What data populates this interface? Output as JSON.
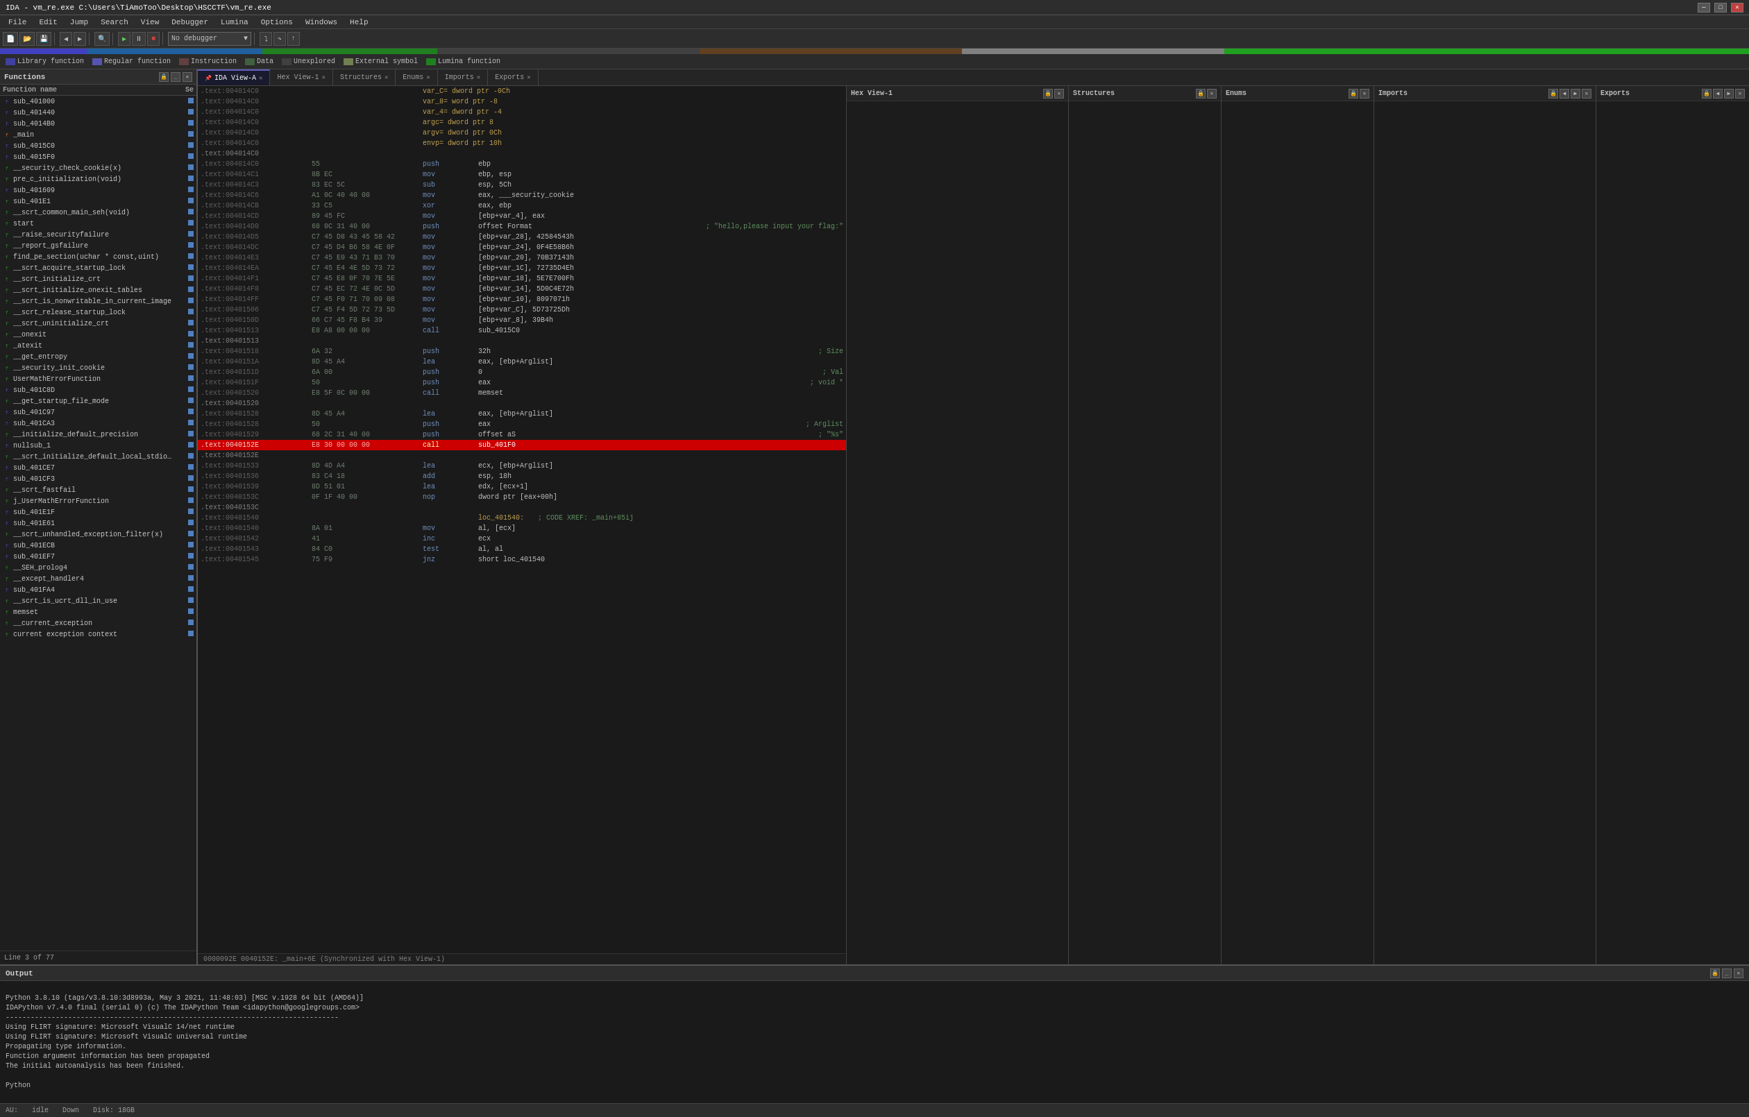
{
  "title_bar": {
    "title": "IDA - vm_re.exe C:\\Users\\TiAmoToo\\Desktop\\HSCCTF\\vm_re.exe",
    "min_label": "─",
    "max_label": "□",
    "close_label": "✕"
  },
  "menu": {
    "items": [
      "File",
      "Edit",
      "Jump",
      "Search",
      "View",
      "Debugger",
      "Lumina",
      "Options",
      "Windows",
      "Help"
    ]
  },
  "toolbar": {
    "debugger_dropdown": "No debugger"
  },
  "legend": {
    "items": [
      {
        "color": "#4040a0",
        "label": "Library function"
      },
      {
        "color": "#5050b0",
        "label": "Regular function"
      },
      {
        "color": "#604040",
        "label": "Instruction"
      },
      {
        "color": "#406040",
        "label": "Data"
      },
      {
        "color": "#404040",
        "label": "Unexplored"
      },
      {
        "color": "#708050",
        "label": "External symbol"
      },
      {
        "color": "#208020",
        "label": "Lumina function"
      }
    ]
  },
  "functions_panel": {
    "title": "Functions",
    "col_name": "Function name",
    "col_se": "Se",
    "items": [
      {
        "icon": "f",
        "icon_color": "#4040a0",
        "name": "sub_401000",
        "bar": 8
      },
      {
        "icon": "f",
        "icon_color": "#4040a0",
        "name": "sub_401440",
        "bar": 8
      },
      {
        "icon": "f",
        "icon_color": "#4040a0",
        "name": "sub_4014B0",
        "bar": 8
      },
      {
        "icon": "f",
        "icon_color": "#c06020",
        "name": "_main",
        "bar": 8
      },
      {
        "icon": "f",
        "icon_color": "#4040a0",
        "name": "sub_4015C0",
        "bar": 8
      },
      {
        "icon": "f",
        "icon_color": "#4040a0",
        "name": "sub_4015F0",
        "bar": 8
      },
      {
        "icon": "f",
        "icon_color": "#208020",
        "name": "__security_check_cookie(x)",
        "bar": 8
      },
      {
        "icon": "f",
        "icon_color": "#208020",
        "name": "pre_c_initialization(void)",
        "bar": 8
      },
      {
        "icon": "f",
        "icon_color": "#4040a0",
        "name": "sub_401609",
        "bar": 8
      },
      {
        "icon": "f",
        "icon_color": "#208020",
        "name": "sub_401E1",
        "bar": 8
      },
      {
        "icon": "f",
        "icon_color": "#208020",
        "name": "__scrt_common_main_seh(void)",
        "bar": 8
      },
      {
        "icon": "f",
        "icon_color": "#208020",
        "name": "start",
        "bar": 8
      },
      {
        "icon": "f",
        "icon_color": "#208020",
        "name": "__raise_securityfailure",
        "bar": 8
      },
      {
        "icon": "f",
        "icon_color": "#208020",
        "name": "__report_gsfailure",
        "bar": 8
      },
      {
        "icon": "f",
        "icon_color": "#208020",
        "name": "find_pe_section(uchar * const,uint)",
        "bar": 8
      },
      {
        "icon": "f",
        "icon_color": "#208020",
        "name": "__scrt_acquire_startup_lock",
        "bar": 8
      },
      {
        "icon": "f",
        "icon_color": "#208020",
        "name": "__scrt_initialize_crt",
        "bar": 8
      },
      {
        "icon": "f",
        "icon_color": "#208020",
        "name": "__scrt_initialize_onexit_tables",
        "bar": 8
      },
      {
        "icon": "f",
        "icon_color": "#208020",
        "name": "__scrt_is_nonwritable_in_current_image",
        "bar": 8
      },
      {
        "icon": "f",
        "icon_color": "#208020",
        "name": "__scrt_release_startup_lock",
        "bar": 8
      },
      {
        "icon": "f",
        "icon_color": "#208020",
        "name": "__scrt_uninitialize_crt",
        "bar": 8
      },
      {
        "icon": "f",
        "icon_color": "#208020",
        "name": "__onexit",
        "bar": 8
      },
      {
        "icon": "f",
        "icon_color": "#208020",
        "name": "_atexit",
        "bar": 8
      },
      {
        "icon": "f",
        "icon_color": "#208020",
        "name": "__get_entropy",
        "bar": 8
      },
      {
        "icon": "f",
        "icon_color": "#208020",
        "name": "__security_init_cookie",
        "bar": 8
      },
      {
        "icon": "f",
        "icon_color": "#208020",
        "name": "UserMathErrorFunction",
        "bar": 8
      },
      {
        "icon": "f",
        "icon_color": "#4040a0",
        "name": "sub_401C8D",
        "bar": 8
      },
      {
        "icon": "f",
        "icon_color": "#208020",
        "name": "__get_startup_file_mode",
        "bar": 8
      },
      {
        "icon": "f",
        "icon_color": "#4040a0",
        "name": "sub_401C97",
        "bar": 8
      },
      {
        "icon": "f",
        "icon_color": "#4040a0",
        "name": "sub_401CA3",
        "bar": 8
      },
      {
        "icon": "f",
        "icon_color": "#208020",
        "name": "__initialize_default_precision",
        "bar": 8
      },
      {
        "icon": "f",
        "icon_color": "#4040a0",
        "name": "nullsub_1",
        "bar": 8
      },
      {
        "icon": "f",
        "icon_color": "#208020",
        "name": "__scrt_initialize_default_local_stdio_opti...",
        "bar": 8
      },
      {
        "icon": "f",
        "icon_color": "#4040a0",
        "name": "sub_401CE7",
        "bar": 8
      },
      {
        "icon": "f",
        "icon_color": "#4040a0",
        "name": "sub_401CF3",
        "bar": 8
      },
      {
        "icon": "f",
        "icon_color": "#208020",
        "name": "__scrt_fastfail",
        "bar": 8
      },
      {
        "icon": "f",
        "icon_color": "#208020",
        "name": "j_UserMathErrorFunction",
        "bar": 8
      },
      {
        "icon": "f",
        "icon_color": "#4040a0",
        "name": "sub_401E1F",
        "bar": 8
      },
      {
        "icon": "f",
        "icon_color": "#4040a0",
        "name": "sub_401E61",
        "bar": 8
      },
      {
        "icon": "f",
        "icon_color": "#208020",
        "name": "__scrt_unhandled_exception_filter(x)",
        "bar": 8
      },
      {
        "icon": "f",
        "icon_color": "#4040a0",
        "name": "sub_401ECB",
        "bar": 8
      },
      {
        "icon": "f",
        "icon_color": "#4040a0",
        "name": "sub_401EF7",
        "bar": 8
      },
      {
        "icon": "f",
        "icon_color": "#208020",
        "name": "__SEH_prolog4",
        "bar": 8
      },
      {
        "icon": "f",
        "icon_color": "#208020",
        "name": "__except_handler4",
        "bar": 8
      },
      {
        "icon": "f",
        "icon_color": "#4040a0",
        "name": "sub_401FA4",
        "bar": 8
      },
      {
        "icon": "f",
        "icon_color": "#208020",
        "name": "__scrt_is_ucrt_dll_in_use",
        "bar": 8
      },
      {
        "icon": "f",
        "icon_color": "#208020",
        "name": "memset",
        "bar": 8
      },
      {
        "icon": "f",
        "icon_color": "#208020",
        "name": "__current_exception",
        "bar": 8
      },
      {
        "icon": "f",
        "icon_color": "#208020",
        "name": "current exception context",
        "bar": 8
      }
    ]
  },
  "tabs": {
    "items": [
      {
        "label": "IDA View-A",
        "active": true,
        "pin": true,
        "closeable": true
      },
      {
        "label": "Hex View-1",
        "active": false,
        "pin": false,
        "closeable": true
      },
      {
        "label": "Structures",
        "active": false,
        "pin": false,
        "closeable": true
      },
      {
        "label": "Enums",
        "active": false,
        "pin": false,
        "closeable": true
      },
      {
        "label": "Imports",
        "active": false,
        "pin": false,
        "closeable": true
      },
      {
        "label": "Exports",
        "active": false,
        "pin": false,
        "closeable": true
      }
    ]
  },
  "asm_view": {
    "lines": [
      {
        "addr": ".text:004014C0",
        "bytes": "",
        "mnem": "",
        "ops": "var_C= dword ptr -0Ch",
        "comment": "",
        "type": "var"
      },
      {
        "addr": ".text:004014C0",
        "bytes": "",
        "mnem": "",
        "ops": "var_8= word ptr -8",
        "comment": "",
        "type": "var"
      },
      {
        "addr": ".text:004014C0",
        "bytes": "",
        "mnem": "",
        "ops": "var_4= dword ptr -4",
        "comment": "",
        "type": "var"
      },
      {
        "addr": ".text:004014C0",
        "bytes": "",
        "mnem": "",
        "ops": "argc= dword ptr  8",
        "comment": "",
        "type": "var"
      },
      {
        "addr": ".text:004014C0",
        "bytes": "",
        "mnem": "",
        "ops": "argv= dword ptr  0Ch",
        "comment": "",
        "type": "var"
      },
      {
        "addr": ".text:004014C0",
        "bytes": "",
        "mnem": "",
        "ops": "envp= dword ptr  10h",
        "comment": "",
        "type": "var"
      },
      {
        "addr": ".text:004014C0",
        "bytes": "",
        "mnem": "",
        "ops": "",
        "comment": "",
        "type": "blank"
      },
      {
        "addr": ".text:004014C0",
        "bytes": "55",
        "mnem": "push",
        "ops": "ebp",
        "comment": "",
        "type": "normal"
      },
      {
        "addr": ".text:004014C1",
        "bytes": "8B EC",
        "mnem": "mov",
        "ops": "ebp, esp",
        "comment": "",
        "type": "normal"
      },
      {
        "addr": ".text:004014C3",
        "bytes": "83 EC 5C",
        "mnem": "sub",
        "ops": "esp, 5Ch",
        "comment": "",
        "type": "normal"
      },
      {
        "addr": ".text:004014C6",
        "bytes": "A1 0C 40 40 00",
        "mnem": "mov",
        "ops": "eax, ___security_cookie",
        "comment": "",
        "type": "normal"
      },
      {
        "addr": ".text:004014CB",
        "bytes": "33 C5",
        "mnem": "xor",
        "ops": "eax, ebp",
        "comment": "",
        "type": "normal"
      },
      {
        "addr": ".text:004014CD",
        "bytes": "89 45 FC",
        "mnem": "mov",
        "ops": "[ebp+var_4], eax",
        "comment": "",
        "type": "normal"
      },
      {
        "addr": ".text:004014D0",
        "bytes": "68 0C 31 40 00",
        "mnem": "push",
        "ops": "offset Format",
        "comment": "; \"hello,please input your flag:\"",
        "type": "normal"
      },
      {
        "addr": ".text:004014D5",
        "bytes": "C7 45 D8 43 45 58 42",
        "mnem": "mov",
        "ops": "[ebp+var_28], 42584543h",
        "comment": "",
        "type": "normal"
      },
      {
        "addr": ".text:004014DC",
        "bytes": "C7 45 D4 B6 58 4E 0F",
        "mnem": "mov",
        "ops": "[ebp+var_24], 0F4E58B6h",
        "comment": "",
        "type": "normal"
      },
      {
        "addr": ".text:004014E3",
        "bytes": "C7 45 E0 43 71 B3 70",
        "mnem": "mov",
        "ops": "[ebp+var_20], 70B37143h",
        "comment": "",
        "type": "normal"
      },
      {
        "addr": ".text:004014EA",
        "bytes": "C7 45 E4 4E 5D 73 72",
        "mnem": "mov",
        "ops": "[ebp+var_1C], 72735D4Eh",
        "comment": "",
        "type": "normal"
      },
      {
        "addr": ".text:004014F1",
        "bytes": "C7 45 E8 0F 70 7E 5E",
        "mnem": "mov",
        "ops": "[ebp+var_18], 5E7E700Fh",
        "comment": "",
        "type": "normal"
      },
      {
        "addr": ".text:004014F8",
        "bytes": "C7 45 EC 72 4E 0C 5D",
        "mnem": "mov",
        "ops": "[ebp+var_14], 5D0C4E72h",
        "comment": "",
        "type": "normal"
      },
      {
        "addr": ".text:004014FF",
        "bytes": "C7 45 F0 71 70 09 08",
        "mnem": "mov",
        "ops": "[ebp+var_10], 8097071h",
        "comment": "",
        "type": "normal"
      },
      {
        "addr": ".text:00401506",
        "bytes": "C7 45 F4 5D 72 73 5D",
        "mnem": "mov",
        "ops": "[ebp+var_C], 5D73725Dh",
        "comment": "",
        "type": "normal"
      },
      {
        "addr": ".text:0040150D",
        "bytes": "66 C7 45 F8 B4 39",
        "mnem": "mov",
        "ops": "[ebp+var_8], 39B4h",
        "comment": "",
        "type": "normal"
      },
      {
        "addr": ".text:00401513",
        "bytes": "E8 A8 00 00 00",
        "mnem": "call",
        "ops": "sub_4015C0",
        "comment": "",
        "type": "normal"
      },
      {
        "addr": ".text:00401513",
        "bytes": "",
        "mnem": "",
        "ops": "",
        "comment": "",
        "type": "blank"
      },
      {
        "addr": ".text:00401518",
        "bytes": "6A 32",
        "mnem": "push",
        "ops": "32h",
        "comment": "; Size",
        "type": "normal"
      },
      {
        "addr": ".text:0040151A",
        "bytes": "8D 45 A4",
        "mnem": "lea",
        "ops": "eax, [ebp+Arglist]",
        "comment": "",
        "type": "normal"
      },
      {
        "addr": ".text:0040151D",
        "bytes": "6A 00",
        "mnem": "push",
        "ops": "0",
        "comment": "; Val",
        "type": "normal"
      },
      {
        "addr": ".text:0040151F",
        "bytes": "50",
        "mnem": "push",
        "ops": "eax",
        "comment": "; void *",
        "type": "normal"
      },
      {
        "addr": ".text:00401520",
        "bytes": "E8 5F 0C 00 00",
        "mnem": "call",
        "ops": "memset",
        "comment": "",
        "type": "normal"
      },
      {
        "addr": ".text:00401520",
        "bytes": "",
        "mnem": "",
        "ops": "",
        "comment": "",
        "type": "blank"
      },
      {
        "addr": ".text:00401528",
        "bytes": "8D 45 A4",
        "mnem": "lea",
        "ops": "eax, [ebp+Arglist]",
        "comment": "",
        "type": "normal"
      },
      {
        "addr": ".text:00401528",
        "bytes": "50",
        "mnem": "push",
        "ops": "eax",
        "comment": "; Arglist",
        "type": "normal"
      },
      {
        "addr": ".text:00401529",
        "bytes": "68 2C 31 40 00",
        "mnem": "push",
        "ops": "offset aS",
        "comment": "; \"%s\"",
        "type": "normal"
      },
      {
        "addr": ".text:0040152E",
        "bytes": "E8 30 00 00 00",
        "mnem": "call",
        "ops": "sub_401F0",
        "comment": "",
        "type": "highlighted"
      },
      {
        "addr": ".text:0040152E",
        "bytes": "",
        "mnem": "",
        "ops": "",
        "comment": "",
        "type": "blank"
      },
      {
        "addr": ".text:00401533",
        "bytes": "8D 4D A4",
        "mnem": "lea",
        "ops": "ecx, [ebp+Arglist]",
        "comment": "",
        "type": "normal"
      },
      {
        "addr": ".text:00401536",
        "bytes": "83 C4 18",
        "mnem": "add",
        "ops": "esp, 18h",
        "comment": "",
        "type": "normal"
      },
      {
        "addr": ".text:00401539",
        "bytes": "8D 51 01",
        "mnem": "lea",
        "ops": "edx, [ecx+1]",
        "comment": "",
        "type": "normal"
      },
      {
        "addr": ".text:0040153C",
        "bytes": "0F 1F 40 00",
        "mnem": "nop",
        "ops": "dword ptr [eax+00h]",
        "comment": "",
        "type": "normal"
      },
      {
        "addr": ".text:0040153C",
        "bytes": "",
        "mnem": "",
        "ops": "",
        "comment": "",
        "type": "blank"
      },
      {
        "addr": ".text:00401540",
        "bytes": "",
        "mnem": "",
        "ops": "loc_401540:",
        "comment": "; CODE XREF: _main+85ij",
        "type": "label"
      },
      {
        "addr": ".text:00401540",
        "bytes": "8A 01",
        "mnem": "mov",
        "ops": "al, [ecx]",
        "comment": "",
        "type": "normal"
      },
      {
        "addr": ".text:00401542",
        "bytes": "41",
        "mnem": "inc",
        "ops": "ecx",
        "comment": "",
        "type": "normal"
      },
      {
        "addr": ".text:00401543",
        "bytes": "84 C0",
        "mnem": "test",
        "ops": "al, al",
        "comment": "",
        "type": "normal"
      },
      {
        "addr": ".text:00401545",
        "bytes": "75 F9",
        "mnem": "jnz",
        "ops": "short loc_401540",
        "comment": "",
        "type": "normal"
      }
    ]
  },
  "status_line": "0000092E 0040152E: _main+6E (Synchronized with Hex View-1)",
  "output_panel": {
    "title": "Output",
    "lines": [
      "",
      "Python 3.8.10 (tags/v3.8.10:3d8993a, May  3 2021, 11:48:03) [MSC v.1928 64 bit (AMD64)]",
      "IDAPython v7.4.0 final (serial 0) (c) The IDAPython Team <idapython@googlegroups.com>",
      "--------------------------------------------------------------------------------",
      "Using FLIRT signature: Microsoft VisualC 14/net runtime",
      "Using FLIRT signature: Microsoft VisualC universal runtime",
      "Propagating type information.",
      "Function argument information has been propagated",
      "The initial autoanalysis has been finished.",
      "",
      "Python"
    ]
  },
  "status_bar": {
    "state": "AU:",
    "cursor": "idle",
    "direction": "Down",
    "disk": "Disk: 18GB"
  },
  "line_info": "Line 3 of 77",
  "imports_tab_label": "Imports",
  "exports_tab_label": "Exports"
}
